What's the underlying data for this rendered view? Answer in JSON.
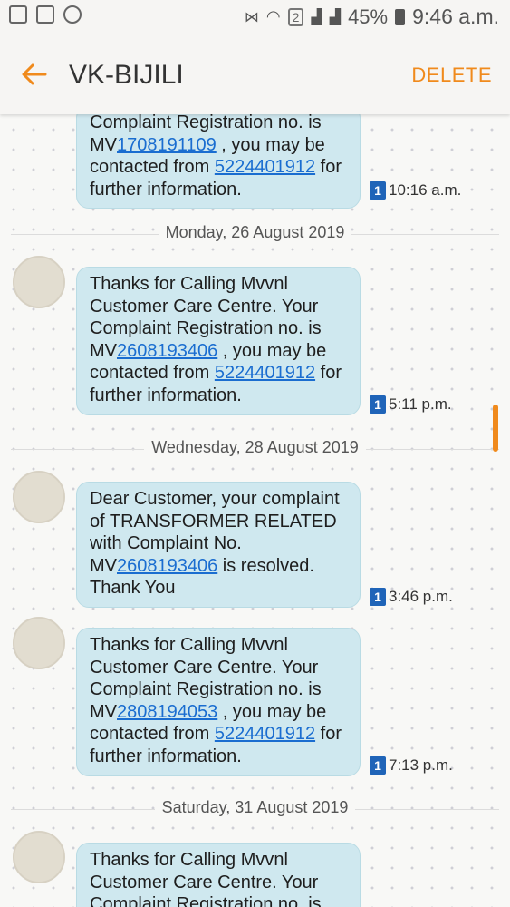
{
  "status_bar": {
    "sim_label": "2",
    "battery_pct": "45%",
    "time": "9:46 a.m."
  },
  "header": {
    "title": "VK-BIJILI",
    "delete_label": "DELETE"
  },
  "messages": [
    {
      "line1": "Complaint Registration no. is",
      "text_prefix": "MV",
      "ref_number": "1708191109",
      "text_mid": " ,  you may be contacted from ",
      "phone": "5224401912",
      "text_suffix": " for further information.",
      "sim": "1",
      "time": "10:16 a.m."
    },
    {
      "date": "Monday, 26 August 2019",
      "text_intro": "Thanks for Calling Mvvnl Customer Care Centre. Your Complaint Registration no. is MV",
      "ref_number": "2608193406",
      "text_mid": " ,  you may be contacted from ",
      "phone": "5224401912",
      "text_suffix": " for further information.",
      "sim": "1",
      "time": "5:11 p.m."
    },
    {
      "date": "Wednesday, 28 August 2019",
      "text_intro": "Dear Customer, your complaint of TRANSFORMER RELATED with Complaint No. MV",
      "ref_number": "2608193406",
      "text_suffix": " is resolved. Thank You",
      "sim": "1",
      "time": "3:46 p.m."
    },
    {
      "text_intro": "Thanks for Calling Mvvnl Customer Care Centre. Your Complaint Registration no. is MV",
      "ref_number": "2808194053",
      "text_mid": " ,  you may be contacted from ",
      "phone": "5224401912",
      "text_suffix": " for further information.",
      "sim": "1",
      "time": "7:13 p.m."
    },
    {
      "date": "Saturday, 31 August 2019",
      "text_intro": "Thanks for Calling Mvvnl Customer Care Centre. Your Complaint Registration no. is"
    }
  ],
  "colors": {
    "accent": "#f08a1c",
    "bubble": "#cfe8ef",
    "link": "#1a6dd0",
    "sim_badge": "#1f64b8"
  }
}
